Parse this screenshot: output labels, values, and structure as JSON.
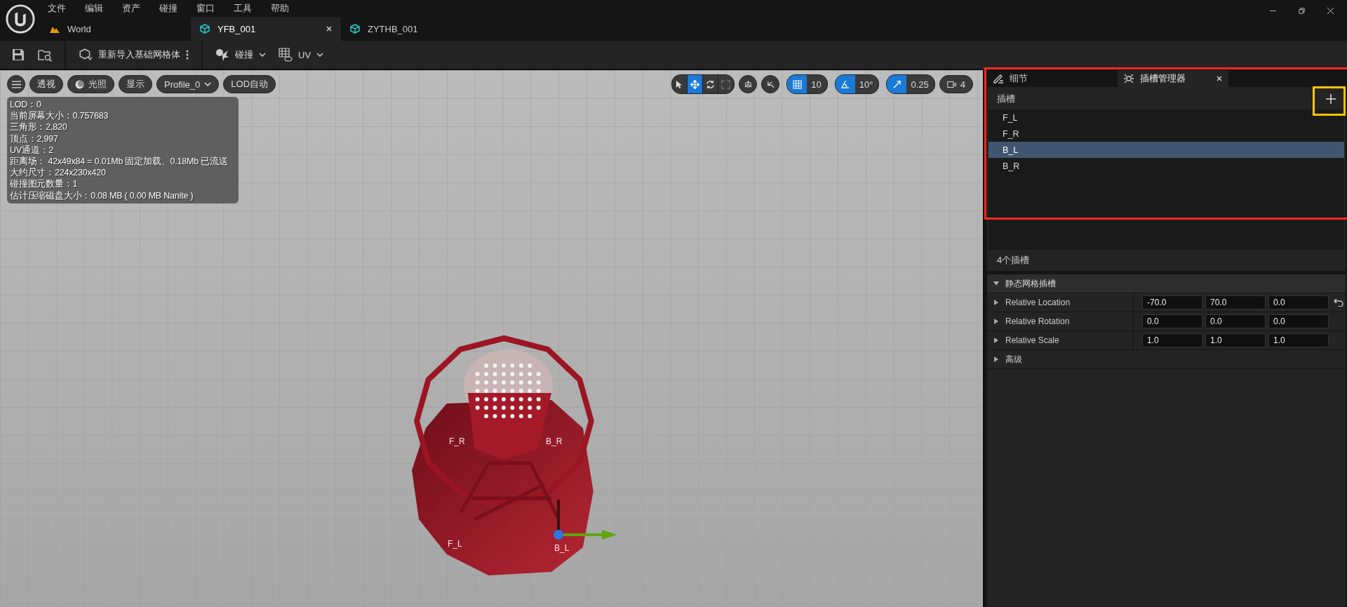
{
  "menu": [
    "文件",
    "编辑",
    "资产",
    "碰撞",
    "窗口",
    "工具",
    "帮助"
  ],
  "document_tabs": [
    {
      "label": "World",
      "kind": "world",
      "selected": false
    },
    {
      "label": "YFB_001",
      "kind": "mesh",
      "selected": true
    },
    {
      "label": "ZYTHB_001",
      "kind": "mesh",
      "selected": false
    }
  ],
  "toolbar": {
    "reimport": "重新导入基础网格体",
    "collision": "碰撞",
    "uv": "UV"
  },
  "viewport": {
    "buttons": [
      {
        "label": "透视",
        "kind": "plain"
      },
      {
        "label": "光照",
        "kind": "lit"
      },
      {
        "label": "显示",
        "kind": "plain"
      },
      {
        "label": "Profile_0",
        "kind": "dropdown"
      },
      {
        "label": "LOD自动",
        "kind": "plain"
      }
    ],
    "stats": [
      "LOD：0",
      "当前屏幕大小：0.757683",
      "三角形：2,820",
      "顶点：2,997",
      "UV通道：2",
      "距离场： 42x49x84 = 0.01Mb 固定加载、0.18Mb 已流送",
      "大约尺寸：224x230x420",
      "碰撞图元数量：1",
      "估计压缩磁盘大小：0.08 MB ( 0.00 MB Nanite )"
    ],
    "transform_tools": [
      {
        "kind": "select",
        "selected": false,
        "disabled": false
      },
      {
        "kind": "move",
        "selected": true,
        "disabled": false
      },
      {
        "kind": "rotate",
        "selected": false,
        "disabled": false
      },
      {
        "kind": "scale",
        "selected": false,
        "disabled": true
      }
    ],
    "snaps": [
      {
        "kind": "grid",
        "value": "10",
        "on": true
      },
      {
        "kind": "angle",
        "value": "10°",
        "on": true
      },
      {
        "kind": "scale",
        "value": "0.25",
        "on": true
      }
    ],
    "camera_speed": "4",
    "socket_labels": [
      "F_R",
      "B_R",
      "F_L",
      "B_L"
    ]
  },
  "panel": {
    "tabs": [
      {
        "label": "细节",
        "kind": "details",
        "selected": false
      },
      {
        "label": "插槽管理器",
        "kind": "sockets",
        "selected": true
      }
    ],
    "list_title": "插槽",
    "sockets": [
      {
        "name": "F_L",
        "selected": false
      },
      {
        "name": "F_R",
        "selected": false
      },
      {
        "name": "B_L",
        "selected": true
      },
      {
        "name": "B_R",
        "selected": false
      }
    ],
    "count": "4个插槽",
    "section": {
      "title": "静态网格插槽",
      "expanded": true
    },
    "properties": [
      {
        "label": "Relative Location",
        "values": [
          "-70.0",
          "70.0",
          "0.0"
        ],
        "resettable": true
      },
      {
        "label": "Relative Rotation",
        "values": [
          "0.0",
          "0.0",
          "0.0"
        ],
        "resettable": false
      },
      {
        "label": "Relative Scale",
        "values": [
          "1.0",
          "1.0",
          "1.0"
        ],
        "resettable": false
      }
    ],
    "advanced": {
      "label": "高级",
      "expanded": false
    }
  },
  "annotations": {
    "socket_panel_outlined": true,
    "add_button_outlined": true
  }
}
